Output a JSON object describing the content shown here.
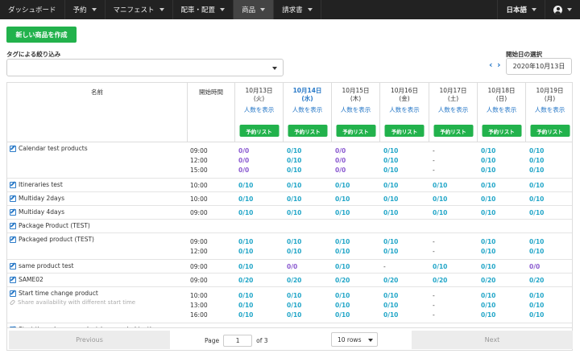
{
  "nav": {
    "items": [
      {
        "label": "ダッシュボード",
        "caret": false,
        "active": false
      },
      {
        "label": "予約",
        "caret": true,
        "active": false
      },
      {
        "label": "マニフェスト",
        "caret": true,
        "active": false
      },
      {
        "label": "配車・配置",
        "caret": true,
        "active": false
      },
      {
        "label": "商品",
        "caret": true,
        "active": true
      },
      {
        "label": "請求書",
        "caret": true,
        "active": false
      }
    ],
    "language": "日本語"
  },
  "create_button": "新しい商品を作成",
  "tag_filter": {
    "label": "タグによる絞り込み",
    "value": ""
  },
  "date_picker": {
    "label": "開始日の選択",
    "prev": "‹",
    "next": "›",
    "value": "2020年10月13日"
  },
  "table": {
    "name_header": "名前",
    "start_header": "開始時間",
    "days": [
      {
        "date": "10月13日",
        "dow": "(火)",
        "today": false
      },
      {
        "date": "10月14日",
        "dow": "(水)",
        "today": true
      },
      {
        "date": "10月15日",
        "dow": "(木)",
        "today": false
      },
      {
        "date": "10月16日",
        "dow": "(金)",
        "today": false
      },
      {
        "date": "10月17日",
        "dow": "(土)",
        "today": false
      },
      {
        "date": "10月18日",
        "dow": "(日)",
        "today": false
      },
      {
        "date": "10月19日",
        "dow": "(月)",
        "today": false
      }
    ],
    "show_count_label": "人数を表示",
    "reserve_list_label": "予約リスト",
    "rows": [
      {
        "name": "Calendar test products",
        "times": [
          "09:00",
          "12:00",
          "15:00"
        ],
        "cells": [
          [
            "0/0",
            "0/10",
            "0/0",
            "0/10",
            "-",
            "0/10",
            "0/10"
          ],
          [
            "0/0",
            "0/10",
            "0/0",
            "0/10",
            "-",
            "0/10",
            "0/10"
          ],
          [
            "0/0",
            "0/10",
            "0/0",
            "0/10",
            "-",
            "0/10",
            "0/10"
          ]
        ]
      },
      {
        "name": "Itineraries test",
        "times": [
          "10:00"
        ],
        "cells": [
          [
            "0/10",
            "0/10",
            "0/10",
            "0/10",
            "0/10",
            "0/10",
            "0/10"
          ]
        ]
      },
      {
        "name": "Multiday 2days",
        "times": [
          "10:00"
        ],
        "cells": [
          [
            "0/10",
            "0/10",
            "0/10",
            "0/10",
            "0/10",
            "0/10",
            "0/10"
          ]
        ]
      },
      {
        "name": "Multiday 4days",
        "times": [
          "09:00"
        ],
        "cells": [
          [
            "0/10",
            "0/10",
            "0/10",
            "0/10",
            "0/10",
            "0/10",
            "0/10"
          ]
        ]
      },
      {
        "name": "Package Product (TEST)",
        "times": [],
        "cells": []
      },
      {
        "name": "Packaged product (TEST)",
        "times": [
          "09:00",
          "12:00"
        ],
        "cells": [
          [
            "0/10",
            "0/10",
            "0/10",
            "0/10",
            "-",
            "0/10",
            "0/10"
          ],
          [
            "0/10",
            "0/10",
            "0/10",
            "0/10",
            "-",
            "0/10",
            "0/10"
          ]
        ]
      },
      {
        "name": "same product test",
        "times": [
          "09:00"
        ],
        "cells": [
          [
            "0/10",
            "0/0",
            "0/10",
            "-",
            "0/10",
            "0/10",
            "0/0"
          ]
        ]
      },
      {
        "name": "SAME02",
        "times": [
          "09:00"
        ],
        "cells": [
          [
            "0/20",
            "0/20",
            "0/20",
            "0/20",
            "0/20",
            "0/20",
            "0/20"
          ]
        ]
      },
      {
        "name": "Start time change product",
        "share": "Share availability with different start time",
        "times": [
          "10:00",
          "13:00",
          "16:00"
        ],
        "cells": [
          [
            "0/10",
            "0/10",
            "0/10",
            "0/10",
            "-",
            "0/10",
            "0/10"
          ],
          [
            "0/10",
            "0/10",
            "0/10",
            "0/10",
            "-",
            "0/10",
            "0/10"
          ],
          [
            "0/10",
            "0/10",
            "0/10",
            "0/10",
            "-",
            "0/10",
            "0/10"
          ]
        ]
      },
      {
        "name": "Start time change product (new period test)",
        "times": [],
        "cells": []
      }
    ]
  },
  "pagination": {
    "previous": "Previous",
    "next": "Next",
    "page_label": "Page",
    "page_value": "1",
    "of_label": "of 3",
    "rows_option": "10 rows"
  },
  "colors": {
    "accent_green": "#22b24c",
    "link_blue": "#2a7ac8",
    "avail_teal": "#22a6c8",
    "avail_purple": "#8a5ad0"
  }
}
